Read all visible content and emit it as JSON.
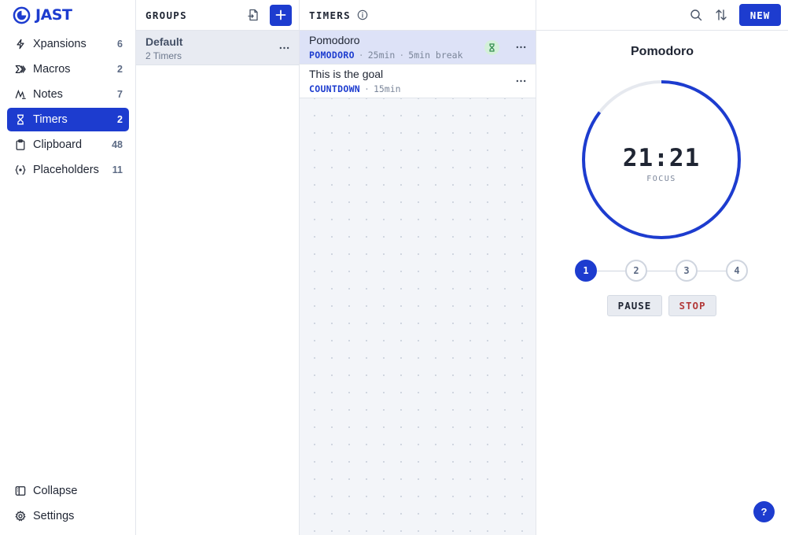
{
  "app": {
    "name": "JAST"
  },
  "sidebar": {
    "items": [
      {
        "label": "Xpansions",
        "count": "6",
        "icon": "lightning-icon"
      },
      {
        "label": "Macros",
        "count": "2",
        "icon": "chevrons-icon"
      },
      {
        "label": "Notes",
        "count": "7",
        "icon": "pen-icon"
      },
      {
        "label": "Timers",
        "count": "2",
        "icon": "hourglass-icon",
        "active": true
      },
      {
        "label": "Clipboard",
        "count": "48",
        "icon": "clipboard-icon"
      },
      {
        "label": "Placeholders",
        "count": "11",
        "icon": "braces-icon"
      }
    ],
    "bottom": [
      {
        "label": "Collapse",
        "icon": "sidebar-collapse-icon"
      },
      {
        "label": "Settings",
        "icon": "gear-icon"
      }
    ]
  },
  "groups": {
    "title": "GROUPS",
    "items": [
      {
        "name": "Default",
        "sub": "2 Timers"
      }
    ]
  },
  "timers": {
    "title": "TIMERS",
    "items": [
      {
        "name": "Pomodoro",
        "type": "POMODORO",
        "duration": "25min",
        "extra": "5min break",
        "selected": true,
        "running": true
      },
      {
        "name": "This is the goal",
        "type": "COUNTDOWN",
        "duration": "15min"
      }
    ]
  },
  "toolbar": {
    "new_label": "NEW"
  },
  "detail": {
    "title": "Pomodoro",
    "time": "21:21",
    "phase": "FOCUS",
    "progress_remaining": 0.854,
    "steps": [
      "1",
      "2",
      "3",
      "4"
    ],
    "active_step": 0,
    "pause_label": "PAUSE",
    "stop_label": "STOP"
  },
  "help": {
    "label": "?"
  },
  "colors": {
    "accent": "#1d3ccf",
    "ring_track": "#e6e9ef",
    "stop": "#b33a3a",
    "running_badge": "#d4f0da"
  }
}
